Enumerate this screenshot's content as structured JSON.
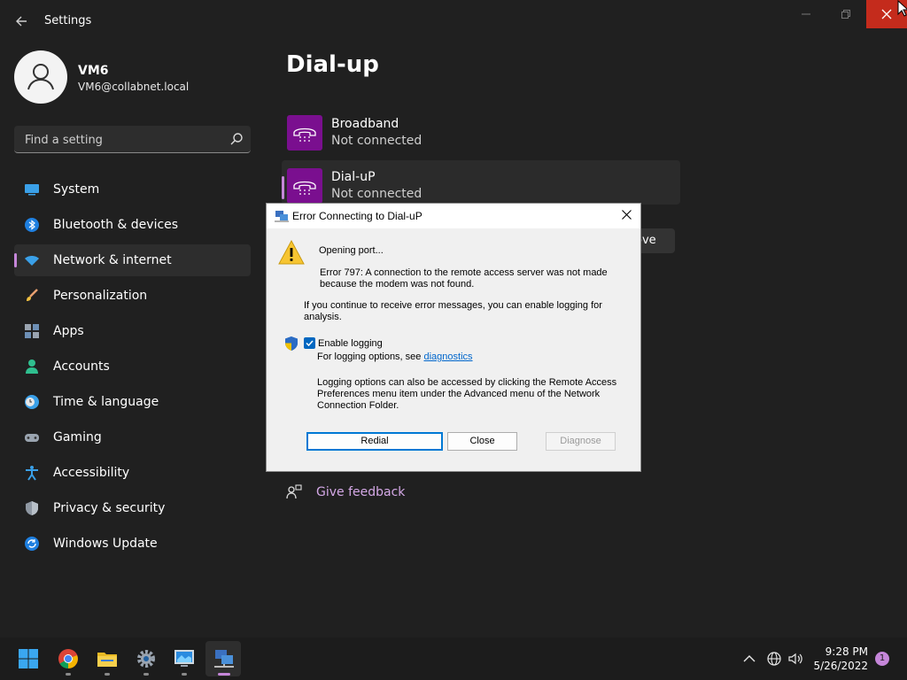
{
  "app": {
    "title": "Settings"
  },
  "window": {
    "close_color": "#c42b1c"
  },
  "user": {
    "name": "VM6",
    "email": "VM6@collabnet.local"
  },
  "search": {
    "placeholder": "Find a setting"
  },
  "sidebar": {
    "accent": "#c586d9",
    "items": [
      {
        "label": "System",
        "icon": "system-icon"
      },
      {
        "label": "Bluetooth & devices",
        "icon": "bluetooth-icon"
      },
      {
        "label": "Network & internet",
        "icon": "network-icon",
        "active": true
      },
      {
        "label": "Personalization",
        "icon": "brush-icon"
      },
      {
        "label": "Apps",
        "icon": "apps-icon"
      },
      {
        "label": "Accounts",
        "icon": "person-icon"
      },
      {
        "label": "Time & language",
        "icon": "clock-globe-icon"
      },
      {
        "label": "Gaming",
        "icon": "gamepad-icon"
      },
      {
        "label": "Accessibility",
        "icon": "accessibility-icon"
      },
      {
        "label": "Privacy & security",
        "icon": "shield-icon"
      },
      {
        "label": "Windows Update",
        "icon": "update-icon"
      }
    ]
  },
  "main": {
    "title": "Dial-up",
    "connections": [
      {
        "name": "Broadband",
        "status": "Not connected",
        "icon": "phone-icon"
      },
      {
        "name": "Dial-uP",
        "status": "Not connected",
        "icon": "phone-icon",
        "selected": true
      }
    ],
    "remove_partial": "ove",
    "feedback": "Give feedback"
  },
  "dialog": {
    "title": "Error Connecting to Dial-uP",
    "status": "Opening port...",
    "error_line1": "Error 797: A connection to the remote access server was not made",
    "error_line2": "because the modem was not found.",
    "info_line1": "If you continue to receive error messages, you can enable logging for",
    "info_line2": "analysis.",
    "checkbox_label": "Enable logging",
    "checkbox_checked": true,
    "logging_prefix": "For logging options, see",
    "logging_link": "diagnostics",
    "note_line1": "Logging options can also be accessed by clicking the Remote Access",
    "note_line2": "Preferences menu item under the Advanced menu of the Network",
    "note_line3": "Connection Folder.",
    "buttons": {
      "redial": "Redial",
      "close": "Close",
      "diagnose": "Diagnose"
    }
  },
  "taskbar": {
    "apps": [
      {
        "name": "start-button",
        "icon": "windows-logo-icon"
      },
      {
        "name": "chrome",
        "icon": "chrome-icon"
      },
      {
        "name": "file-explorer",
        "icon": "folder-icon"
      },
      {
        "name": "settings",
        "icon": "gear-icon"
      },
      {
        "name": "remote-desktop",
        "icon": "monitor-icon"
      },
      {
        "name": "network-connections",
        "icon": "network-connection-icon",
        "active": true
      }
    ],
    "time": "9:28 PM",
    "date": "5/26/2022",
    "notifications": "1"
  }
}
